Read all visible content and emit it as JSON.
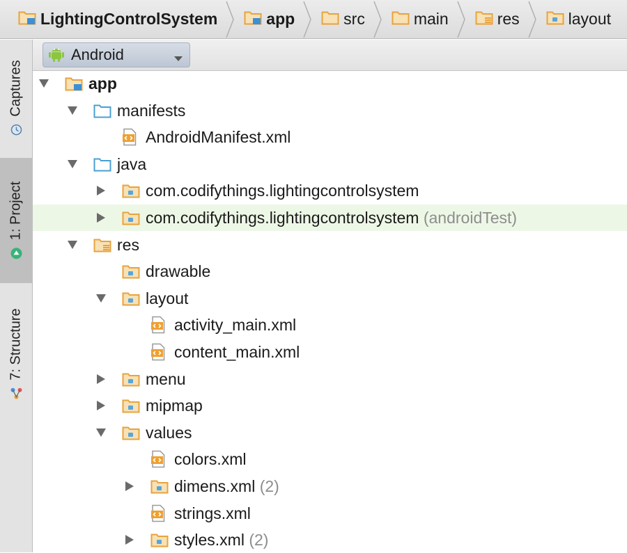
{
  "breadcrumb": [
    {
      "label": "LightingControlSystem",
      "icon": "module-folder-icon",
      "bold": true
    },
    {
      "label": "app",
      "icon": "module-folder-icon",
      "bold": true
    },
    {
      "label": "src",
      "icon": "folder-icon",
      "bold": false
    },
    {
      "label": "main",
      "icon": "folder-icon",
      "bold": false
    },
    {
      "label": "res",
      "icon": "res-folder-icon",
      "bold": false
    },
    {
      "label": "layout",
      "icon": "package-folder-icon",
      "bold": false
    }
  ],
  "toolwindows": [
    {
      "label": "Captures",
      "icon": "captures-icon"
    },
    {
      "label": "1: Project",
      "icon": "android-project-icon",
      "selected": true
    },
    {
      "label": "7: Structure",
      "icon": "structure-icon"
    }
  ],
  "panel": {
    "view_mode": "Android"
  },
  "tree": [
    {
      "label": "app",
      "icon": "module-folder-icon",
      "toggle": "expanded",
      "bold": true
    },
    {
      "label": "manifests",
      "icon": "blue-folder-icon",
      "toggle": "expanded"
    },
    {
      "label": "AndroidManifest.xml",
      "icon": "xml-file-icon",
      "toggle": "none"
    },
    {
      "label": "java",
      "icon": "blue-folder-icon",
      "toggle": "expanded"
    },
    {
      "label": "com.codifythings.lightingcontrolsystem",
      "icon": "package-folder-icon",
      "toggle": "collapsed"
    },
    {
      "label": "com.codifythings.lightingcontrolsystem",
      "suffix": "(androidTest)",
      "icon": "package-folder-icon",
      "toggle": "collapsed",
      "highlight": true
    },
    {
      "label": "res",
      "icon": "res-folder-icon",
      "toggle": "expanded"
    },
    {
      "label": "drawable",
      "icon": "package-folder-icon",
      "toggle": "none"
    },
    {
      "label": "layout",
      "icon": "package-folder-icon",
      "toggle": "expanded"
    },
    {
      "label": "activity_main.xml",
      "icon": "xml-file-icon",
      "toggle": "none"
    },
    {
      "label": "content_main.xml",
      "icon": "xml-file-icon",
      "toggle": "none"
    },
    {
      "label": "menu",
      "icon": "package-folder-icon",
      "toggle": "collapsed"
    },
    {
      "label": "mipmap",
      "icon": "package-folder-icon",
      "toggle": "collapsed"
    },
    {
      "label": "values",
      "icon": "package-folder-icon",
      "toggle": "expanded"
    },
    {
      "label": "colors.xml",
      "icon": "xml-file-icon",
      "toggle": "none"
    },
    {
      "label": "dimens.xml",
      "suffix": "(2)",
      "icon": "package-folder-icon",
      "toggle": "collapsed"
    },
    {
      "label": "strings.xml",
      "icon": "xml-file-icon",
      "toggle": "none"
    },
    {
      "label": "styles.xml",
      "suffix": "(2)",
      "icon": "package-folder-icon",
      "toggle": "collapsed"
    }
  ],
  "colors": {
    "folder": "#e7a33e",
    "folder_fill": "#f7e1b5",
    "blue_folder": "#4a9fd4",
    "module_badge": "#3d8fd6",
    "xml_badge": "#f0a030",
    "android_green": "#8cc63f",
    "selection_green": "#edf7e6"
  }
}
